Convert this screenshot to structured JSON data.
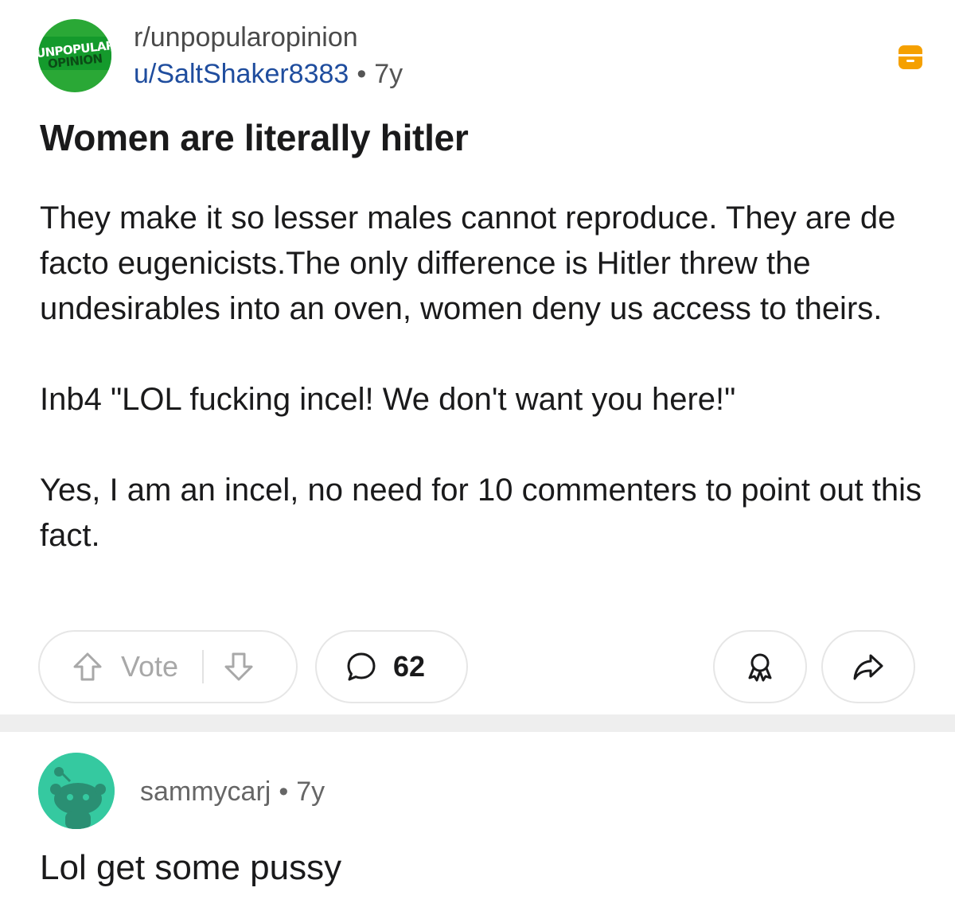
{
  "post": {
    "subreddit": "r/unpopularopinion",
    "subreddit_logo": {
      "line1": "UNPOPULAR",
      "line2": "OPINION"
    },
    "author": "u/SaltShaker8383",
    "separator": "•",
    "age": "7y",
    "title": "Women are literally hitler",
    "body": [
      "They make it so lesser males cannot reproduce. They are de facto eugenicists.The only difference is Hitler threw the undesirables into an oven, women deny us access to theirs.",
      "Inb4 \"LOL fucking incel! We don't want you here!\"",
      "Yes, I am an incel, no need for 10 commenters to point out this fact."
    ]
  },
  "actions": {
    "vote_label": "Vote",
    "comment_count": "62",
    "icons": [
      "upvote-icon",
      "downvote-icon",
      "comment-icon",
      "award-icon",
      "share-icon",
      "archive-icon"
    ]
  },
  "comment": {
    "author": "sammycarj",
    "separator": "•",
    "age": "7y",
    "body": "Lol get some pussy"
  },
  "colors": {
    "author_link": "#1f4d9e",
    "archive_icon": "#f5a000",
    "subreddit_logo": "#2aa836",
    "comment_avatar": "#35c9a0"
  }
}
